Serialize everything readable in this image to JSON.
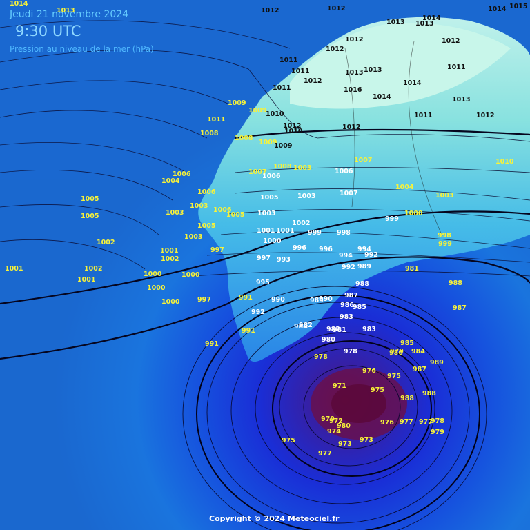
{
  "header": {
    "date": "Jeudi 21 novembre 2024",
    "time": "9:30 UTC",
    "title": "Pression au niveau de la mer (hPa)"
  },
  "footer": {
    "copyright": "Copyright © 2024 Meteociel.fr"
  },
  "colors": {
    "label_sea": "#f7f23a",
    "label_land": "#111111",
    "label_white": "#ffffff",
    "low_core": "#6a0f4a",
    "deep_sea": "#1430c8",
    "land_light": "#b8f5e8"
  },
  "pressure_labels": [
    "1014",
    "1013",
    "1012",
    "1012",
    "1014",
    "1015",
    "1013",
    "1014",
    "1013",
    "1012",
    "1012",
    "1012",
    "1011",
    "1011",
    "1013",
    "1013",
    "1012",
    "1011",
    "1011",
    "1014",
    "1016",
    "1014",
    "1013",
    "1009",
    "1009",
    "1010",
    "1012",
    "1012",
    "1011",
    "1012",
    "1008",
    "1008",
    "1009",
    "1010",
    "1009",
    "1011",
    "1007",
    "1006",
    "1006",
    "1008",
    "1003",
    "1006",
    "1007",
    "1003",
    "1007",
    "1010",
    "1004",
    "1005",
    "1006",
    "1004",
    "1003",
    "1003",
    "1005",
    "1005",
    "1005",
    "1006",
    "1003",
    "1003",
    "1003",
    "1005",
    "1002",
    "1001",
    "1001",
    "1000",
    "1000",
    "1002",
    "999",
    "998",
    "999",
    "1000",
    "998",
    "999",
    "997",
    "996",
    "996",
    "994",
    "994",
    "992",
    "992",
    "1001",
    "1001",
    "1001",
    "1002",
    "1002",
    "1000",
    "1000",
    "1000",
    "997",
    "997",
    "993",
    "990",
    "989",
    "988",
    "991",
    "990",
    "992",
    "995",
    "991",
    "991",
    "989",
    "988",
    "987",
    "987",
    "986",
    "985",
    "984",
    "983",
    "982",
    "981",
    "980",
    "979",
    "978",
    "978",
    "977",
    "976",
    "975",
    "975",
    "974",
    "973",
    "973",
    "972",
    "971",
    "970",
    "975",
    "976",
    "977",
    "977",
    "978",
    "979",
    "980",
    "981",
    "982",
    "983",
    "984",
    "985",
    "986",
    "987",
    "988",
    "988",
    "989",
    "990",
    "984",
    "983",
    "982",
    "980",
    "979",
    "978",
    "977",
    "976",
    "975"
  ],
  "cities_note": ""
}
